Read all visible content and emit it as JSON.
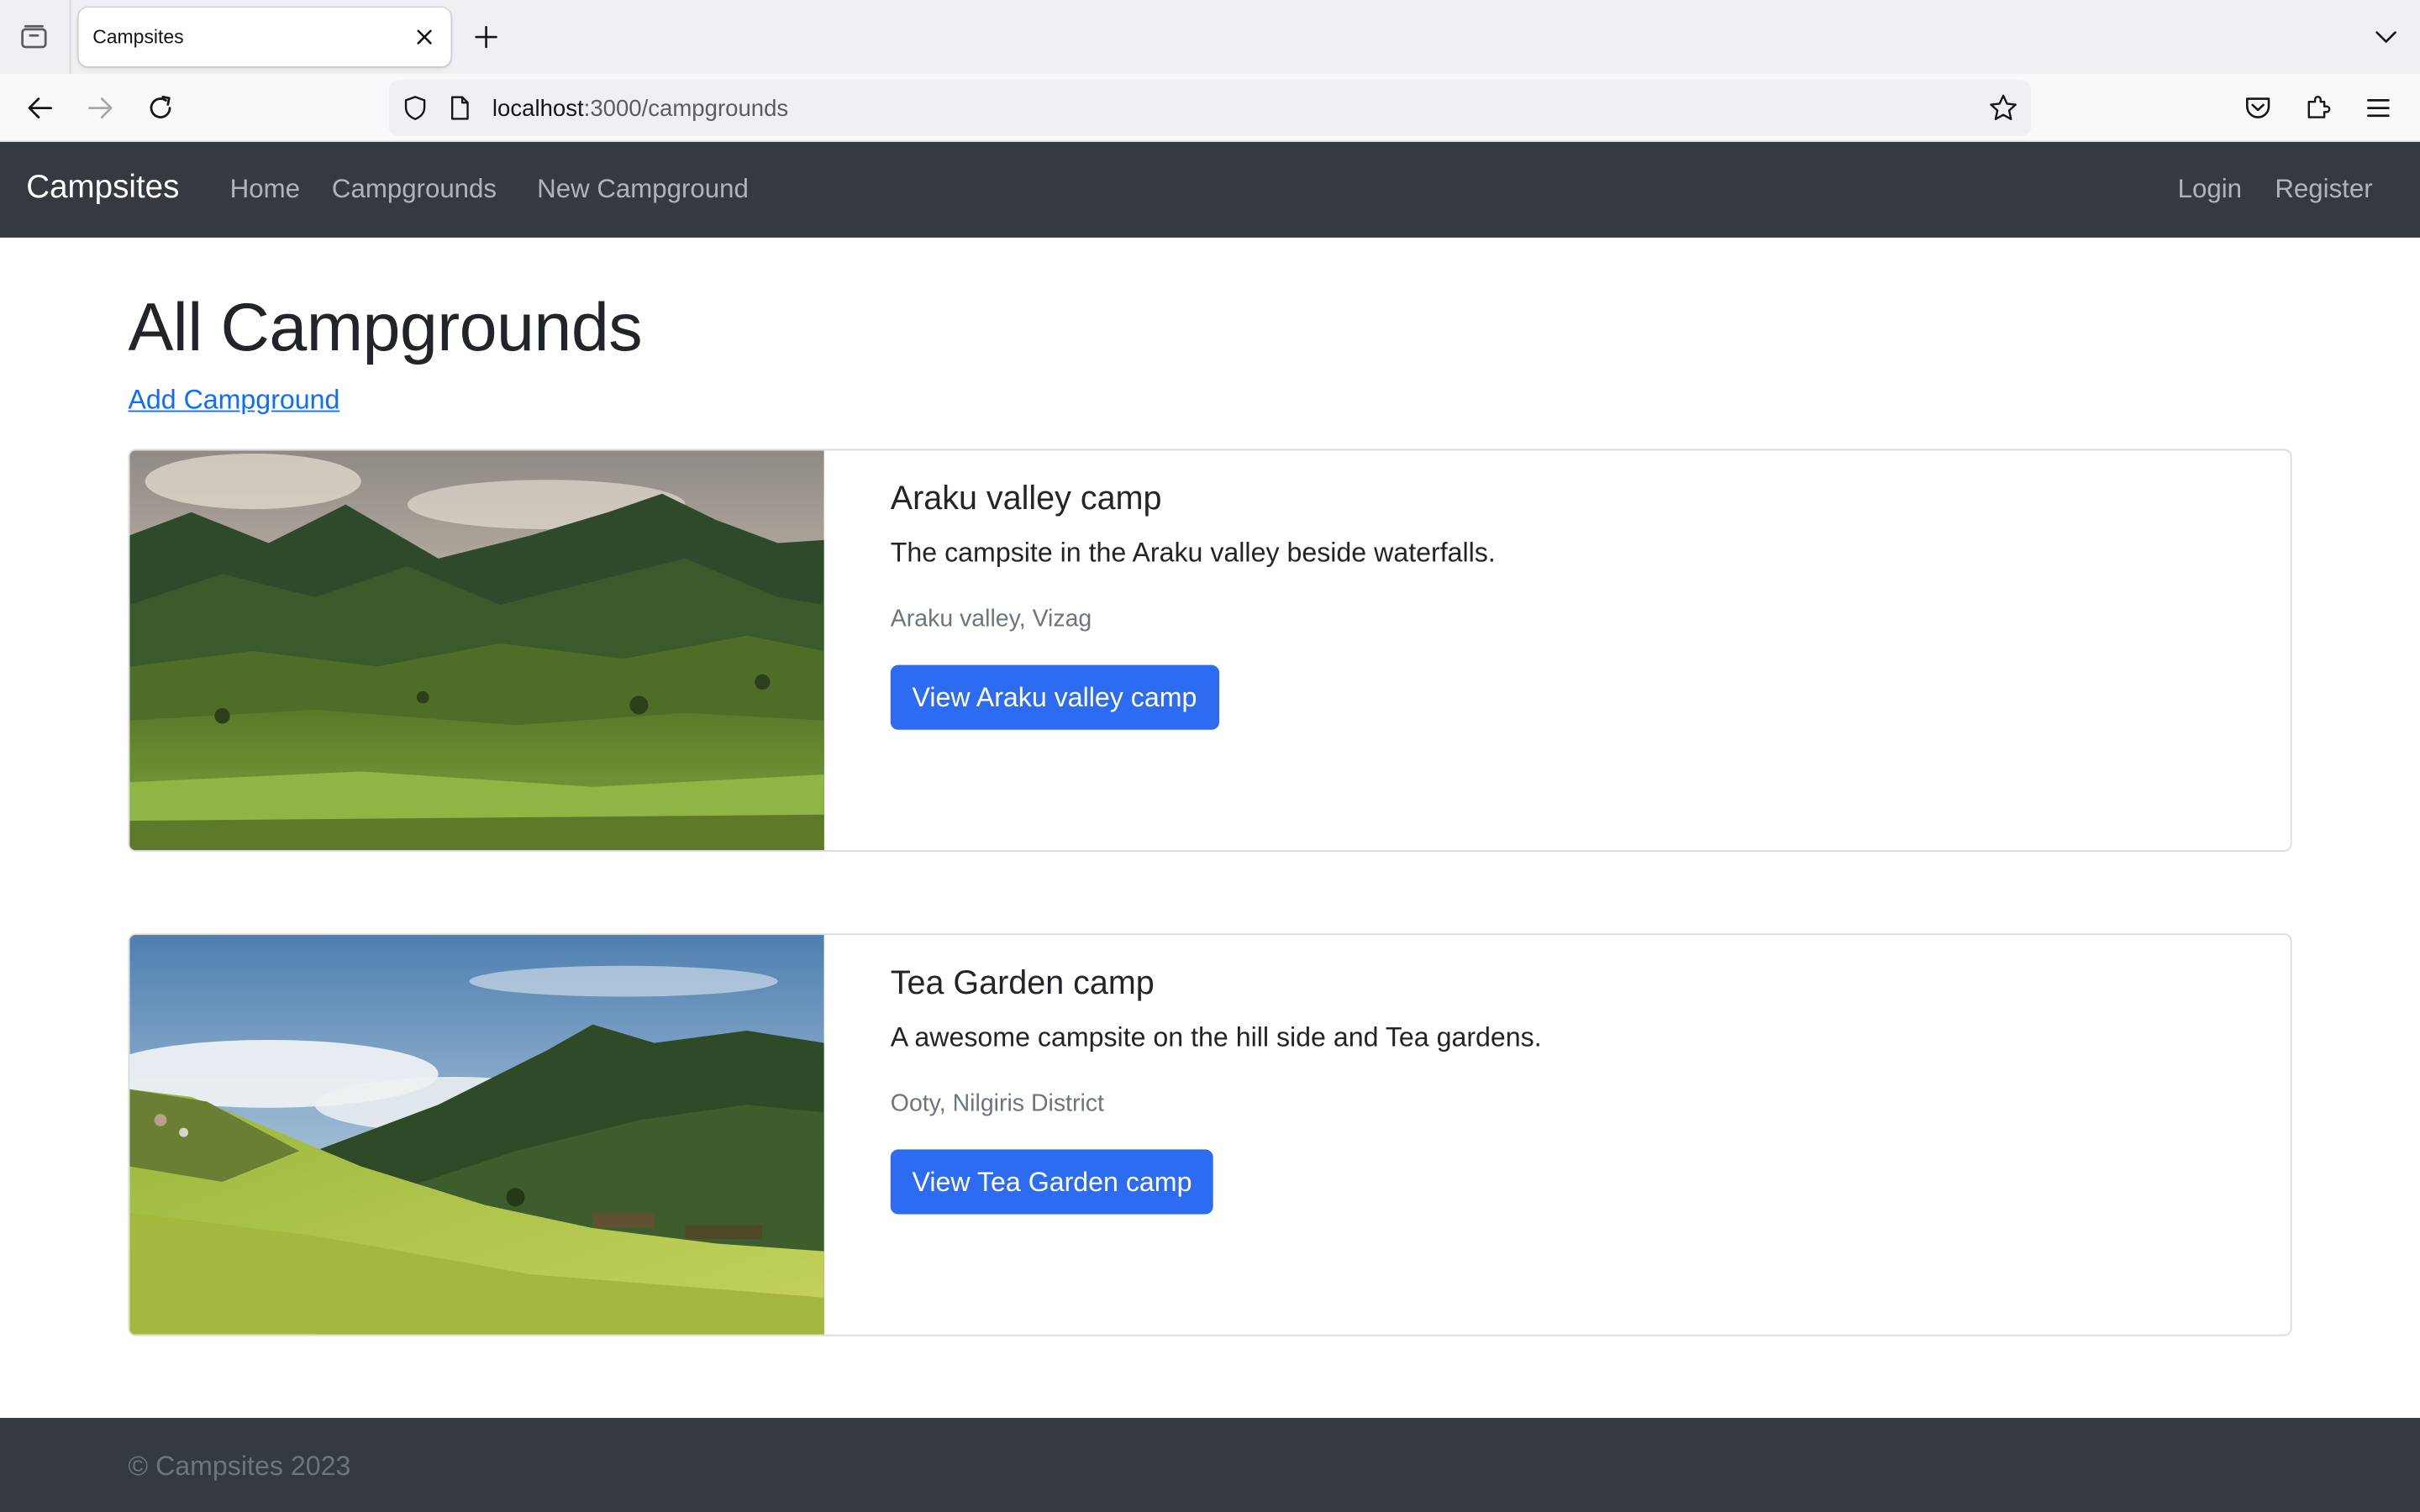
{
  "browser": {
    "tab_title": "Campsites",
    "url_host": "localhost",
    "url_rest": ":3000/campgrounds"
  },
  "site": {
    "brand": "Campsites",
    "nav_links": [
      "Home",
      "Campgrounds",
      "New Campground"
    ],
    "auth_links": [
      "Login",
      "Register"
    ]
  },
  "main": {
    "title": "All Campgrounds",
    "add_link": "Add Campground"
  },
  "campgrounds": [
    {
      "title": "Araku valley camp",
      "description": "The campsite in the Araku valley beside waterfalls.",
      "location": "Araku valley, Vizag",
      "button": "View Araku valley camp"
    },
    {
      "title": "Tea Garden camp",
      "description": "A awesome campsite on the hill side and Tea gardens.",
      "location": "Ooty, Nilgiris District",
      "button": "View Tea Garden camp"
    }
  ],
  "footer": {
    "text": "© Campsites 2023"
  },
  "icons": {
    "tab_list": "tab-list-icon",
    "close": "close-icon",
    "new_tab": "plus-icon",
    "overflow": "chevron-down-icon",
    "back": "back-arrow-icon",
    "forward": "forward-arrow-icon",
    "reload": "reload-icon",
    "shield": "shield-icon",
    "page": "page-icon",
    "bookmark": "star-icon",
    "pocket": "pocket-icon",
    "extensions": "puzzle-icon",
    "menu": "hamburger-menu-icon"
  },
  "colors": {
    "site_nav_bg": "#343a40",
    "primary_button": "#2d6cf0",
    "link": "#0d6efd"
  }
}
